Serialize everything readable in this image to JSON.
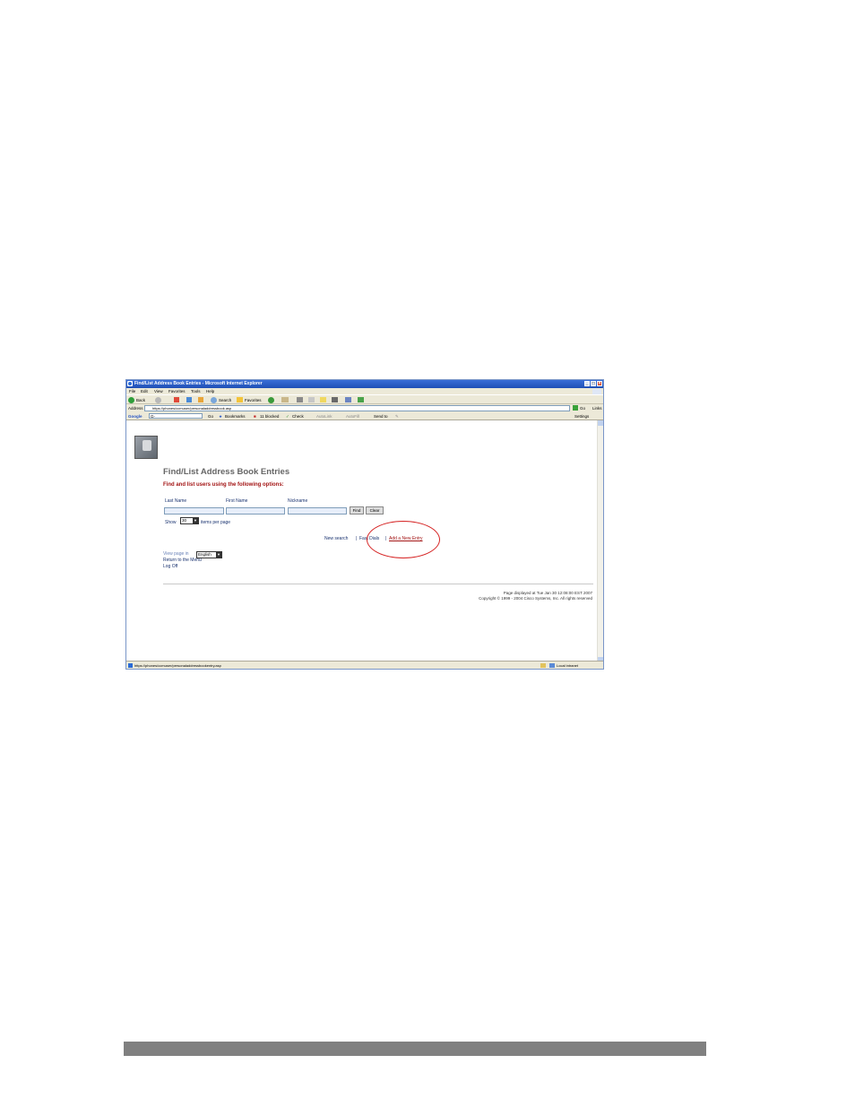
{
  "window": {
    "title": "Find/List Address Book Entries - Microsoft Internet Explorer",
    "controls": [
      "_",
      "□",
      "×"
    ]
  },
  "menu": [
    "File",
    "Edit",
    "View",
    "Favorites",
    "Tools",
    "Help"
  ],
  "toolbar": {
    "back": "Back",
    "search": "Search",
    "favorites": "Favorites"
  },
  "address": {
    "label": "Address",
    "url": "https://phones/ccmuser/personaladdressbook.asp",
    "go": "Go",
    "links": "Links"
  },
  "google_bar": {
    "logo": "Google",
    "field": "G-",
    "go": "Go",
    "bookmarks": "Bookmarks",
    "blocked": "11 blocked",
    "check": "Check",
    "autolink": "AutoLink",
    "autofill": "AutoFill",
    "send_to": "Send to",
    "settings": "Settings"
  },
  "page": {
    "title": "Find/List Address Book Entries",
    "subtitle": "Find and list users using the following options:",
    "labels": {
      "last_name": "Last Name",
      "first_name": "First Name",
      "nickname": "Nickname"
    },
    "find_button": "Find",
    "clear_button": "Clear",
    "show_label": "Show",
    "show_value": "30",
    "items_per_page": "items per page",
    "links": {
      "new_search": "New search",
      "fast_dials": "Fast Dials",
      "add_new_entry": "Add a New Entry",
      "separator": "|"
    },
    "view_page_in": "View page in",
    "language": "English",
    "return_menu": "Return to the Menu",
    "log_off": "Log Off",
    "footer_line1": "Page displayed at Tue Jan 30 12:08:00 EST 2007",
    "footer_line2": "Copyright © 1999 - 2004 Cisco Systems, Inc. All rights reserved"
  },
  "status": {
    "url": "https://phones/ccmuser/personaladdressbookentry.asp",
    "zone": "Local intranet"
  },
  "colors": {
    "accent_red": "#a31515",
    "link_blue": "#1a3370",
    "annotation_circle": "#d62525"
  }
}
